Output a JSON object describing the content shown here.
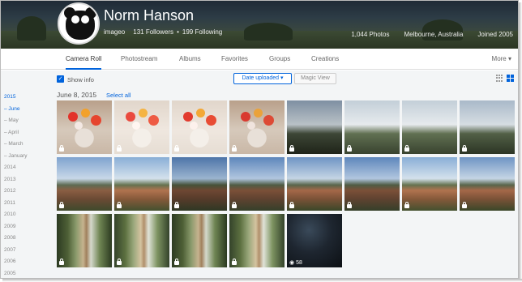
{
  "profile": {
    "name": "Norm Hanson",
    "username": "imageo",
    "followers": "131 Followers",
    "separator": "•",
    "following": "199 Following",
    "photos": "1,044 Photos",
    "location": "Melbourne, Australia",
    "joined": "Joined 2005"
  },
  "tabs": {
    "items": [
      {
        "label": "Camera Roll"
      },
      {
        "label": "Photostream"
      },
      {
        "label": "Albums"
      },
      {
        "label": "Favorites"
      },
      {
        "label": "Groups"
      },
      {
        "label": "Creations"
      }
    ],
    "more": "More ▾",
    "active": "Camera Roll"
  },
  "toolbar": {
    "show_info": "Show info",
    "show_info_checked": true,
    "sort_button": "Date uploaded ▾",
    "magic_view": "Magic View"
  },
  "sidebar": {
    "items": [
      {
        "label": "2015"
      },
      {
        "label": "– June"
      },
      {
        "label": "– May"
      },
      {
        "label": "– April"
      },
      {
        "label": "– March"
      },
      {
        "label": "– January"
      },
      {
        "label": "2014"
      },
      {
        "label": "2013"
      },
      {
        "label": "2012"
      },
      {
        "label": "2011"
      },
      {
        "label": "2010"
      },
      {
        "label": "2009"
      },
      {
        "label": "2008"
      },
      {
        "label": "2007"
      },
      {
        "label": "2006"
      },
      {
        "label": "2005"
      }
    ]
  },
  "gallery": {
    "date_header": "June 8, 2015",
    "select_all": "Select all",
    "view_count": "58"
  },
  "colors": {
    "accent": "#0063dc",
    "page_bg": "#f3f5f6"
  }
}
